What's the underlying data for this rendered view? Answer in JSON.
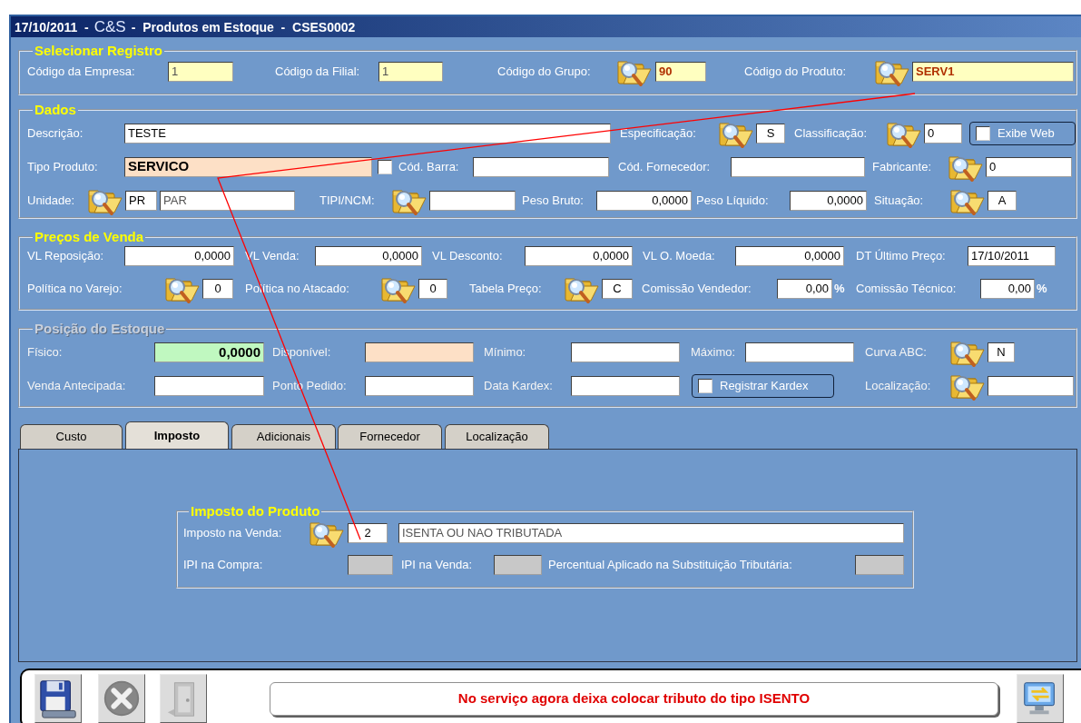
{
  "window": {
    "title_parts": [
      "17/10/2011  -",
      "C&S",
      "-  Produtos em Estoque  -  CSES0002"
    ]
  },
  "sections": [
    {
      "title": "Selecionar Registro",
      "disabled": false,
      "items": [
        {
          "kind": "label",
          "text": "Código da Empresa:"
        },
        {
          "kind": "field",
          "value": "1"
        },
        {
          "kind": "label",
          "text": "Código da Filial:"
        },
        {
          "kind": "field",
          "value": "1"
        },
        {
          "kind": "label",
          "text": "Código do Grupo:"
        },
        {
          "kind": "lookup"
        },
        {
          "kind": "field",
          "value": "90"
        },
        {
          "kind": "label",
          "text": "Código do Produto:"
        },
        {
          "kind": "lookup"
        },
        {
          "kind": "field",
          "value": "SERV1"
        }
      ]
    },
    {
      "title": "Dados",
      "disabled": false,
      "items": [
        {
          "kind": "label",
          "text": "Descrição:"
        },
        {
          "kind": "field",
          "value": "TESTE"
        },
        {
          "kind": "label",
          "text": "Especificação:"
        },
        {
          "kind": "lookup"
        },
        {
          "kind": "field",
          "value": "S"
        },
        {
          "kind": "label",
          "text": "Classificação:"
        },
        {
          "kind": "lookup"
        },
        {
          "kind": "field",
          "value": "0"
        },
        {
          "kind": "checkbox",
          "label": "Exibe Web",
          "checked": false
        },
        {
          "kind": "label",
          "text": "Tipo Produto:"
        },
        {
          "kind": "field",
          "value": "SERVICO"
        },
        {
          "kind": "checkbox",
          "checked": false
        },
        {
          "kind": "label",
          "text": "Cód. Barra:"
        },
        {
          "kind": "field"
        },
        {
          "kind": "label",
          "text": "Cód. Fornecedor:"
        },
        {
          "kind": "field"
        },
        {
          "kind": "label",
          "text": "Fabricante:"
        },
        {
          "kind": "lookup"
        },
        {
          "kind": "field",
          "value": "0"
        },
        {
          "kind": "label",
          "text": "Unidade:"
        },
        {
          "kind": "lookup"
        },
        {
          "kind": "field",
          "value": "PR"
        },
        {
          "kind": "field",
          "value": "PAR"
        },
        {
          "kind": "label",
          "text": "TIPI/NCM:"
        },
        {
          "kind": "lookup"
        },
        {
          "kind": "field"
        },
        {
          "kind": "label",
          "text": "Peso Bruto:"
        },
        {
          "kind": "field",
          "value": "0,0000"
        },
        {
          "kind": "label",
          "text": "Peso Líquido:"
        },
        {
          "kind": "field",
          "value": "0,0000"
        },
        {
          "kind": "label",
          "text": "Situação:"
        },
        {
          "kind": "lookup"
        },
        {
          "kind": "field",
          "value": "A"
        }
      ]
    },
    {
      "title": "Preços de Venda",
      "disabled": false,
      "items": [
        {
          "kind": "label",
          "text": "VL Reposição:"
        },
        {
          "kind": "field",
          "value": "0,0000"
        },
        {
          "kind": "label",
          "text": "VL Venda:"
        },
        {
          "kind": "field",
          "value": "0,0000"
        },
        {
          "kind": "label",
          "text": "VL Desconto:"
        },
        {
          "kind": "field",
          "value": "0,0000"
        },
        {
          "kind": "label",
          "text": "VL O. Moeda:"
        },
        {
          "kind": "field",
          "value": "0,0000"
        },
        {
          "kind": "label",
          "text": "DT Último Preço:"
        },
        {
          "kind": "field",
          "value": "17/10/2011"
        },
        {
          "kind": "label",
          "text": "Política no Varejo:"
        },
        {
          "kind": "lookup"
        },
        {
          "kind": "field",
          "value": "0"
        },
        {
          "kind": "label",
          "text": "Política no Atacado:"
        },
        {
          "kind": "lookup"
        },
        {
          "kind": "field",
          "value": "0"
        },
        {
          "kind": "label",
          "text": "Tabela Preço:"
        },
        {
          "kind": "lookup"
        },
        {
          "kind": "field",
          "value": "C"
        },
        {
          "kind": "label",
          "text": "Comissão Vendedor:"
        },
        {
          "kind": "field",
          "value": "0,00"
        },
        {
          "kind": "label",
          "text": "%"
        },
        {
          "kind": "label",
          "text": "Comissão Técnico:"
        },
        {
          "kind": "field",
          "value": "0,00"
        },
        {
          "kind": "label",
          "text": "%"
        }
      ]
    },
    {
      "title": "Posição do Estoque",
      "disabled": true,
      "items": [
        {
          "kind": "label",
          "text": "Físico:"
        },
        {
          "kind": "field",
          "value": "0,0000"
        },
        {
          "kind": "label",
          "text": "Disponível:"
        },
        {
          "kind": "field"
        },
        {
          "kind": "label",
          "text": "Mínimo:"
        },
        {
          "kind": "field"
        },
        {
          "kind": "label",
          "text": "Máximo:"
        },
        {
          "kind": "field"
        },
        {
          "kind": "label",
          "text": "Curva ABC:"
        },
        {
          "kind": "lookup"
        },
        {
          "kind": "field",
          "value": "N"
        },
        {
          "kind": "label",
          "text": "Venda Antecipada:"
        },
        {
          "kind": "field"
        },
        {
          "kind": "label",
          "text": "Ponto Pedido:"
        },
        {
          "kind": "field"
        },
        {
          "kind": "label",
          "text": "Data Kardex:"
        },
        {
          "kind": "field"
        },
        {
          "kind": "checkbox",
          "label": "Registrar Kardex",
          "checked": false
        },
        {
          "kind": "label",
          "text": "Localização:"
        },
        {
          "kind": "lookup"
        },
        {
          "kind": "field"
        }
      ]
    }
  ],
  "tabs": [
    {
      "label": "Custo",
      "selected": false
    },
    {
      "label": "Imposto",
      "selected": true
    },
    {
      "label": "Adicionais",
      "selected": false
    },
    {
      "label": "Fornecedor",
      "selected": false
    },
    {
      "label": "Localização",
      "selected": false
    }
  ],
  "tax_group": {
    "title": "Imposto do Produto",
    "items": [
      {
        "kind": "label",
        "text": "Imposto na Venda:"
      },
      {
        "kind": "lookup"
      },
      {
        "kind": "field",
        "value": "2"
      },
      {
        "kind": "field",
        "value": "ISENTA OU NAO TRIBUTADA"
      },
      {
        "kind": "label",
        "text": "IPI na Compra:"
      },
      {
        "kind": "field"
      },
      {
        "kind": "label",
        "text": "IPI na Venda:"
      },
      {
        "kind": "field"
      },
      {
        "kind": "label",
        "text": "Percentual Aplicado na Substituição Tributária:"
      },
      {
        "kind": "field"
      }
    ]
  },
  "toolbar": [
    {
      "kind": "save",
      "disabled": false
    },
    {
      "kind": "cancel",
      "disabled": true
    },
    {
      "kind": "door",
      "disabled": true
    }
  ],
  "message": "No serviço agora deixa colocar tributo do tipo ISENTO",
  "exit_button": {
    "kind": "exit",
    "disabled": false
  }
}
